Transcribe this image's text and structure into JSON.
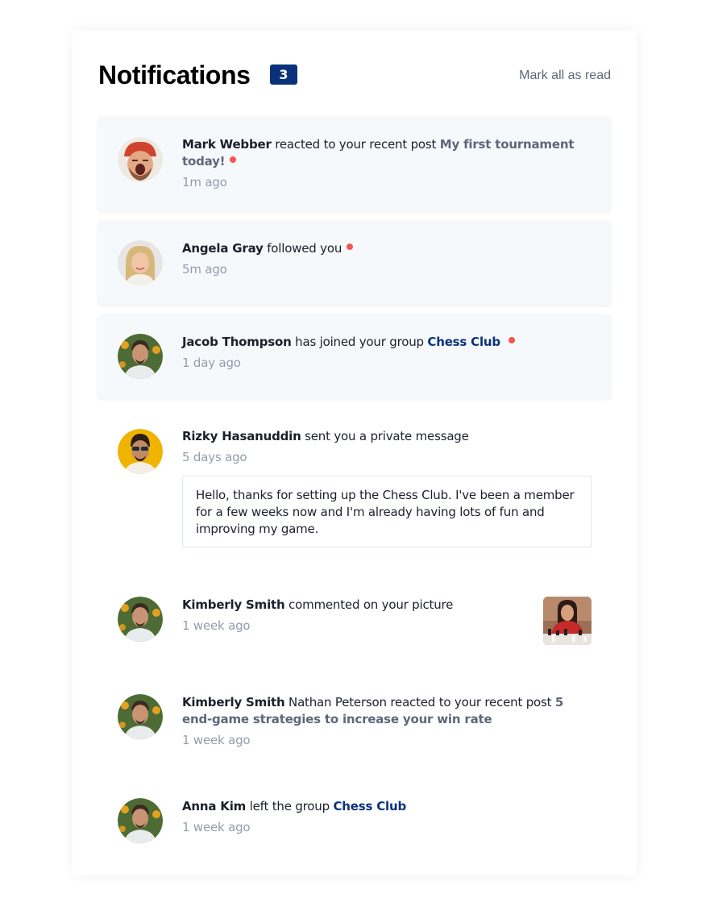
{
  "header": {
    "title": "Notifications",
    "unread_count": "3",
    "mark_all_label": "Mark all as read"
  },
  "notifications": [
    {
      "name": "Mark Webber",
      "action": "reacted to your recent post",
      "post": "My first tournament today!",
      "time": "1m ago",
      "unread": true,
      "avatar": "avatar-mark-webber"
    },
    {
      "name": "Angela Gray",
      "action": "followed you",
      "time": "5m ago",
      "unread": true,
      "avatar": "avatar-angela-gray"
    },
    {
      "name": "Jacob Thompson",
      "action": "has joined your group",
      "group": "Chess Club",
      "time": "1 day ago",
      "unread": true,
      "avatar": "avatar-jacob-thompson"
    },
    {
      "name": "Rizky Hasanuddin",
      "action": "sent you a private message",
      "time": "5 days ago",
      "message": "Hello, thanks for setting up the Chess Club. I've been a member for a few weeks now and I'm already having lots of fun and improving my game.",
      "unread": false,
      "avatar": "avatar-rizky-hasanuddin"
    },
    {
      "name": "Kimberly Smith",
      "action": "commented on your picture",
      "time": "1 week ago",
      "unread": false,
      "avatar": "avatar-kimberly-smith",
      "picture": "chess-picture-thumbnail"
    },
    {
      "name": "Kimberly Smith",
      "action": "Nathan Peterson reacted to your recent post",
      "post": "5 end-game strategies to increase your win rate",
      "time": "1 week ago",
      "unread": false,
      "avatar": "avatar-kimberly-smith"
    },
    {
      "name": "Anna Kim",
      "action": "left the group",
      "group": "Chess Club",
      "time": "1 week ago",
      "unread": false,
      "avatar": "avatar-anna-kim"
    }
  ],
  "colors": {
    "accent_blue": "#0a327b",
    "unread_bg": "#f6f9fc",
    "dot_red": "#f65552",
    "muted_text": "#939cad",
    "secondary_text": "#5e6778"
  }
}
